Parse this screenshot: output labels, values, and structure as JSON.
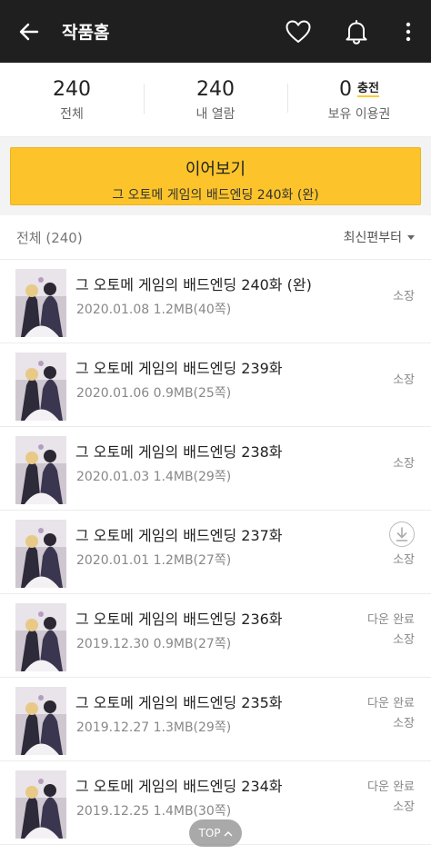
{
  "appbar": {
    "title": "작품홈",
    "icons": [
      "back-arrow-icon",
      "heart-icon",
      "bell-icon",
      "more-vertical-icon"
    ]
  },
  "stats": {
    "total": {
      "value": "240",
      "label": "전체"
    },
    "read": {
      "value": "240",
      "label": "내 열람"
    },
    "tickets": {
      "value": "0",
      "label": "보유 이용권",
      "charge": "충전"
    }
  },
  "continue": {
    "label": "이어보기",
    "episode": "그 오토메 게임의 배드엔딩 240화 (완)"
  },
  "list": {
    "count": "전체 (240)",
    "sort": "최신편부터"
  },
  "episodes": [
    {
      "title": "그 오토메 게임의 배드엔딩 240화 (완)",
      "meta": "2020.01.08   1.2MB(40쪽)",
      "status1": "",
      "status2": "소장"
    },
    {
      "title": "그 오토메 게임의 배드엔딩 239화",
      "meta": "2020.01.06   0.9MB(25쪽)",
      "status1": "",
      "status2": "소장"
    },
    {
      "title": "그 오토메 게임의 배드엔딩 238화",
      "meta": "2020.01.03   1.4MB(29쪽)",
      "status1": "",
      "status2": "소장"
    },
    {
      "title": "그 오토메 게임의 배드엔딩 237화",
      "meta": "2020.01.01   1.2MB(27쪽)",
      "status1": "",
      "status2": "소장"
    },
    {
      "title": "그 오토메 게임의 배드엔딩 236화",
      "meta": "2019.12.30   0.9MB(27쪽)",
      "status1": "다운 완료",
      "status2": "소장"
    },
    {
      "title": "그 오토메 게임의 배드엔딩 235화",
      "meta": "2019.12.27   1.3MB(29쪽)",
      "status1": "다운 완료",
      "status2": "소장"
    },
    {
      "title": "그 오토메 게임의 배드엔딩 234화",
      "meta": "2019.12.25   1.4MB(30쪽)",
      "status1": "다운 완료",
      "status2": "소장"
    }
  ],
  "top_button": "TOP",
  "colors": {
    "appbar": "#1f1f1f",
    "accent": "#fcc42a"
  }
}
